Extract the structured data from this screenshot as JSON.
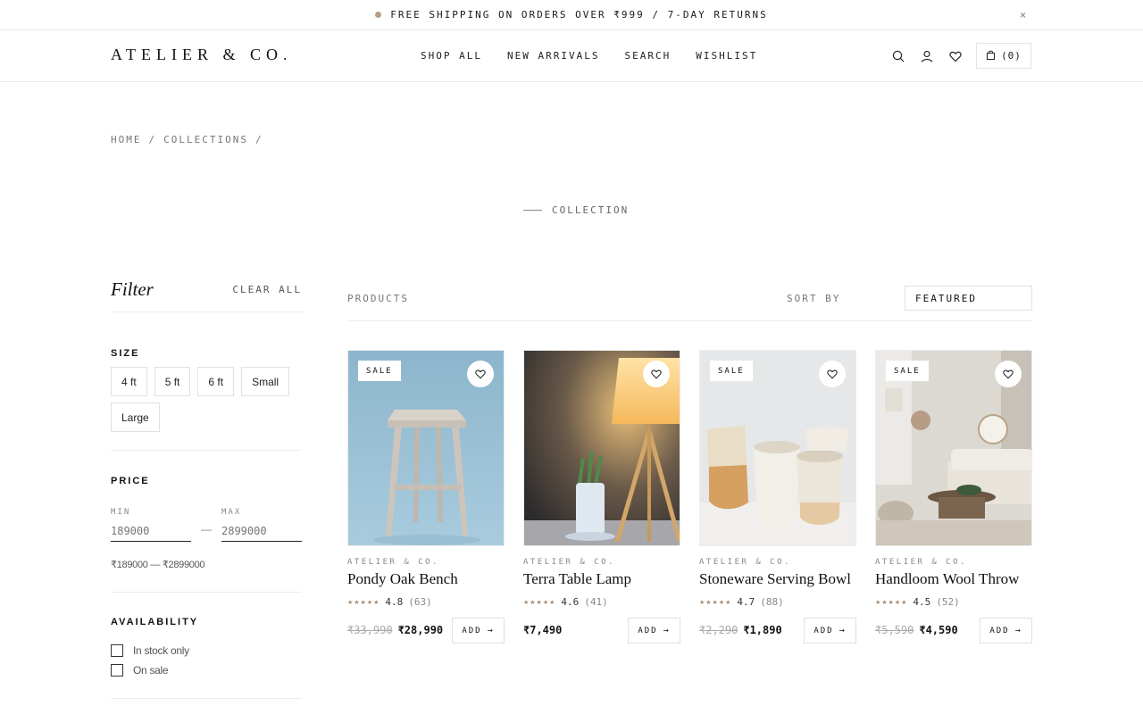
{
  "announcement": {
    "text": "FREE SHIPPING ON ORDERS OVER ₹999 / 7-DAY RETURNS",
    "close": "×"
  },
  "header": {
    "logo": "ATELIER & CO.",
    "nav": [
      "SHOP ALL",
      "NEW ARRIVALS",
      "SEARCH",
      "WISHLIST"
    ],
    "icons": [
      "search-icon",
      "account-icon",
      "wishlist-icon"
    ],
    "cart_count": "(0)"
  },
  "breadcrumb": {
    "home": "HOME",
    "sep": "/",
    "collections": "COLLECTIONS",
    "sep2": "/"
  },
  "eyebrow": "COLLECTION",
  "filter": {
    "title": "Filter",
    "clear_all": "CLEAR ALL",
    "size": {
      "label": "SIZE",
      "options": [
        "4 ft",
        "5 ft",
        "6 ft",
        "Small",
        "Large"
      ]
    },
    "price": {
      "label": "PRICE",
      "min_label": "MIN",
      "max_label": "MAX",
      "min_placeholder": "189000",
      "max_placeholder": "2899000",
      "dash": "—",
      "range_text": "₹189000 — ₹2899000"
    },
    "availability": {
      "label": "AVAILABILITY",
      "options": [
        "In stock only",
        "On sale"
      ]
    }
  },
  "products_bar": {
    "label": "PRODUCTS",
    "sort_label": "SORT BY",
    "sort_value": "FEATURED"
  },
  "products": [
    {
      "badge": "SALE",
      "brand": "ATELIER & CO.",
      "name": "Pondy Oak Bench",
      "stars": "★★★★★",
      "rating": "4.8",
      "reviews": "(63)",
      "old_price": "₹33,990",
      "price": "₹28,990",
      "add": "ADD",
      "arrow": "→"
    },
    {
      "badge": "",
      "brand": "ATELIER & CO.",
      "name": "Terra Table Lamp",
      "stars": "★★★★★",
      "rating": "4.6",
      "reviews": "(41)",
      "old_price": "",
      "price": "₹7,490",
      "add": "ADD",
      "arrow": "→"
    },
    {
      "badge": "SALE",
      "brand": "ATELIER & CO.",
      "name": "Stoneware Serving Bowl",
      "stars": "★★★★★",
      "rating": "4.7",
      "reviews": "(88)",
      "old_price": "₹2,290",
      "price": "₹1,890",
      "add": "ADD",
      "arrow": "→"
    },
    {
      "badge": "SALE",
      "brand": "ATELIER & CO.",
      "name": "Handloom Wool Throw",
      "stars": "★★★★★",
      "rating": "4.5",
      "reviews": "(52)",
      "old_price": "₹5,590",
      "price": "₹4,590",
      "add": "ADD",
      "arrow": "→"
    }
  ],
  "colors": {
    "accent": "#b79d86",
    "border": "#ececec",
    "text": "#1a1a1a"
  }
}
